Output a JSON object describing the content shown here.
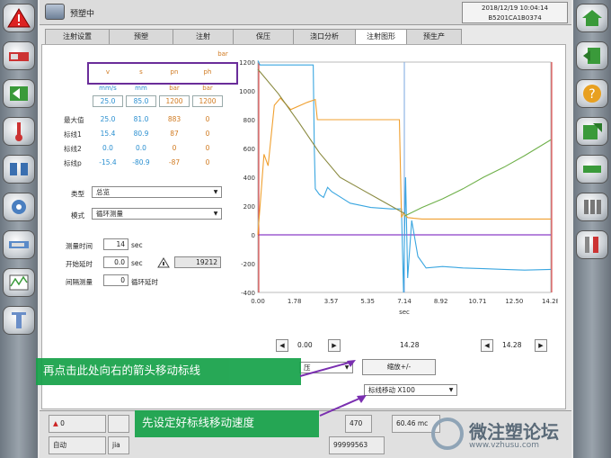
{
  "header": {
    "title": "预塑中",
    "datetime": "2018/12/19 10:04:14",
    "machine_id": "B5201CA1B0374"
  },
  "tabs": [
    "注射设置",
    "预塑",
    "注射",
    "保压",
    "浇口分析",
    "注射图形",
    "预生产"
  ],
  "table": {
    "unit_top": "bar",
    "columns": [
      "v",
      "s",
      "pn",
      "ph"
    ],
    "units": [
      "mm/s",
      "mm",
      "bar",
      "bar"
    ],
    "scale_values": [
      "25.0",
      "85.0",
      "1200",
      "1200"
    ],
    "rows": [
      {
        "label": "最大值",
        "values": [
          "25.0",
          "81.0",
          "883",
          "0"
        ]
      },
      {
        "label": "标线1",
        "values": [
          "15.4",
          "80.9",
          "87",
          "0"
        ]
      },
      {
        "label": "标线2",
        "values": [
          "0.0",
          "0.0",
          "0",
          "0"
        ]
      },
      {
        "label": "标线p",
        "values": [
          "-15.4",
          "-80.9",
          "-87",
          "0"
        ]
      }
    ]
  },
  "controls": {
    "type_label": "类型",
    "type_value": "总览",
    "mode_label": "模式",
    "mode_value": "循环测量",
    "measure_time_label": "测量时间",
    "measure_time_value": "14",
    "measure_time_unit": "sec",
    "start_delay_label": "开始延时",
    "start_delay_value": "0.0",
    "start_delay_unit": "sec",
    "counter_value": "19212",
    "interval_label": "间隔测量",
    "interval_value": "0",
    "interval_unit": "循环延时"
  },
  "nav": {
    "left_value": "0.00",
    "mid_value": "14.28",
    "right_value": "14.28",
    "zoom_label": "缩放+/-",
    "cursor_move_value": "标线移动 X100",
    "partial_select": "压"
  },
  "status": {
    "alarm_count": "0",
    "mode": "自动",
    "user": "jia",
    "n470": "470",
    "rate": "60.46 mc",
    "counter": "99999563"
  },
  "callouts": {
    "first": "再点击此处向右的箭头移动标线",
    "second": "先设定好标线移动速度"
  },
  "watermark": {
    "name": "微注塑论坛",
    "url": "www.vzhusu.com"
  },
  "chart_data": {
    "type": "line",
    "xlabel": "sec",
    "xlim": [
      0,
      14.28
    ],
    "ylim": [
      -400,
      1200
    ],
    "x_ticks": [
      "0.00",
      "1.78",
      "3.57",
      "5.35",
      "7.14",
      "8.92",
      "10.71",
      "12.50",
      "14.28"
    ],
    "y_ticks": [
      "-400",
      "-200",
      "0",
      "200",
      "400",
      "600",
      "800",
      "1000",
      "1200"
    ],
    "cursor_x": 7.14,
    "colors": {
      "blue": "#3aa6e0",
      "orange": "#f0a030",
      "olive": "#8a8a40",
      "green": "#6fb04a",
      "purple": "#8a3cc8",
      "red": "#e03030"
    },
    "series": [
      {
        "color": "blue",
        "x": [
          0,
          0.1,
          1.5,
          2.7,
          2.75,
          2.8,
          3.0,
          3.2,
          3.4,
          3.6,
          4.5,
          5.5,
          6.5,
          7.0,
          7.1,
          7.2,
          7.3,
          7.5,
          7.8,
          8.2,
          9,
          10,
          11,
          12,
          13,
          14.28
        ],
        "y": [
          1210,
          1180,
          1180,
          1180,
          600,
          320,
          280,
          260,
          330,
          300,
          220,
          190,
          180,
          180,
          -400,
          400,
          -300,
          100,
          -150,
          -230,
          -220,
          -230,
          -235,
          -240,
          -245,
          -240
        ]
      },
      {
        "color": "orange",
        "x": [
          0,
          0.3,
          0.5,
          0.8,
          1.1,
          1.6,
          2.4,
          2.8,
          2.9,
          3.1,
          6.9,
          7.0,
          7.1,
          7.3,
          7.6,
          8,
          10,
          12,
          14.28
        ],
        "y": [
          0,
          560,
          480,
          900,
          950,
          870,
          920,
          940,
          800,
          800,
          800,
          120,
          150,
          120,
          115,
          110,
          110,
          110,
          110
        ]
      },
      {
        "color": "olive",
        "x": [
          0,
          1,
          2,
          3,
          4,
          5,
          6,
          7,
          7.14
        ],
        "y": [
          1150,
          980,
          780,
          570,
          400,
          320,
          240,
          160,
          150
        ]
      },
      {
        "color": "green",
        "x": [
          7.14,
          8,
          9,
          10,
          11,
          12,
          13,
          14.28
        ],
        "y": [
          130,
          190,
          250,
          320,
          400,
          470,
          550,
          660
        ]
      }
    ]
  }
}
